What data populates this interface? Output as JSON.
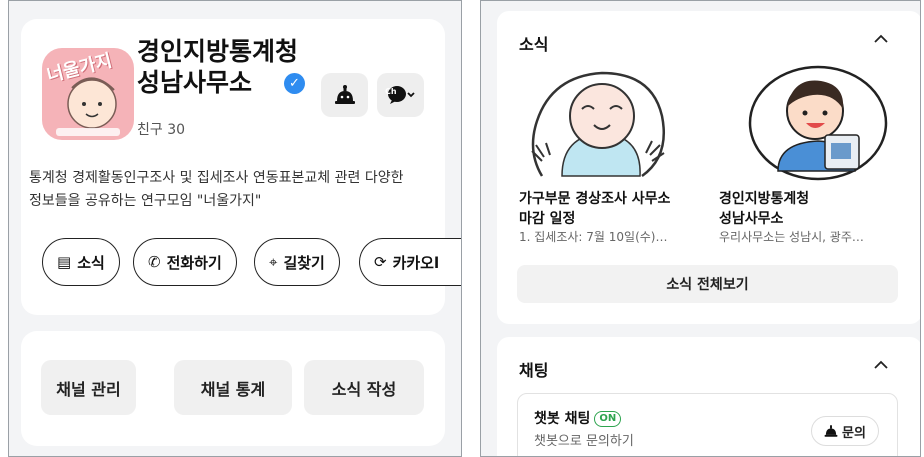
{
  "profile": {
    "avatar_text": "너울가지",
    "name_line1": "경인지방통계청",
    "name_line2": "성남사무소",
    "verified_mark": "✓",
    "friends": "친구 30",
    "description_line1": "통계청 경제활동인구조사 및 집세조사 연동표본교체 관련 다양한",
    "description_line2": "정보들을 공유하는 연구모임 \"너울가지\"",
    "bot_icon": "chatbot-icon",
    "channel_menu_label": "Ch",
    "actions": [
      {
        "label": "소식",
        "icon": "▤"
      },
      {
        "label": "전화하기",
        "icon": "✆"
      },
      {
        "label": "길찾기",
        "icon": "⌖"
      },
      {
        "label": "카카오l",
        "icon": "⟳"
      }
    ]
  },
  "admin": {
    "manage": "채널 관리",
    "stats": "채널 통계",
    "write": "소식 작성"
  },
  "news": {
    "title": "소식",
    "items": [
      {
        "title_line1": "가구부문 경상조사 사무소",
        "title_line2": "마감 일정",
        "summary": "1. 집세조사: 7월 10일(수)…"
      },
      {
        "title_line1": "경인지방통계청",
        "title_line2": "성남사무소",
        "summary": "우리사무소는 성남시, 광주…"
      }
    ],
    "view_all": "소식 전체보기"
  },
  "chat": {
    "title": "채팅",
    "bot_label": "챗봇 채팅",
    "on_badge": "ON",
    "bot_desc": "챗봇으로 문의하기",
    "ask_label": "문의"
  },
  "colors": {
    "accent_verified": "#2f8cf0",
    "on_green": "#2ea44f",
    "avatar_pink": "#f5b3b8"
  }
}
